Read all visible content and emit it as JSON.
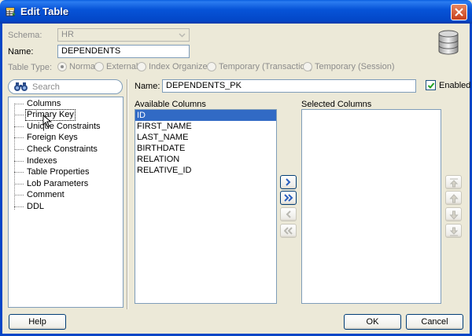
{
  "window": {
    "title": "Edit Table"
  },
  "form": {
    "schema_label": "Schema:",
    "schema_value": "HR",
    "name_label": "Name:",
    "name_value": "DEPENDENTS",
    "table_type_label": "Table Type:",
    "table_types": [
      "Normal",
      "External",
      "Index Organized",
      "Temporary (Transaction)",
      "Temporary (Session)"
    ],
    "table_type_selected": "Normal"
  },
  "sidebar": {
    "search_placeholder": "Search",
    "items": [
      "Columns",
      "Primary Key",
      "Unique Constraints",
      "Foreign Keys",
      "Check Constraints",
      "Indexes",
      "Table Properties",
      "Lob Parameters",
      "Comment",
      "DDL"
    ],
    "selected": "Primary Key"
  },
  "pk": {
    "name_label": "Name:",
    "name_value": "DEPENDENTS_PK",
    "enabled_label": "Enabled",
    "enabled": true,
    "available_label": "Available Columns",
    "available_columns": [
      "ID",
      "FIRST_NAME",
      "LAST_NAME",
      "BIRTHDATE",
      "RELATION",
      "RELATIVE_ID"
    ],
    "available_selected": "ID",
    "selected_label": "Selected Columns",
    "selected_columns": []
  },
  "buttons": {
    "help": "Help",
    "ok": "OK",
    "cancel": "Cancel"
  },
  "colors": {
    "titlebar": "#0346c7",
    "selection": "#316ac5",
    "background": "#ece9d8"
  }
}
